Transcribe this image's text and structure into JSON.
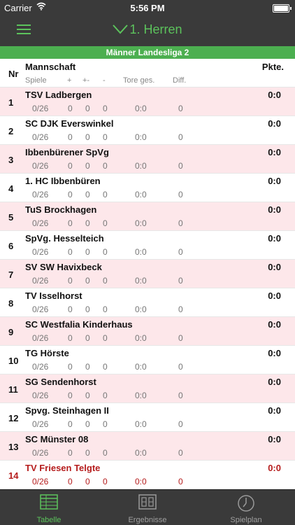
{
  "status_bar": {
    "carrier": "Carrier",
    "time": "5:56 PM"
  },
  "nav": {
    "title": "1. Herren"
  },
  "league": {
    "name": "Männer Landesliga 2"
  },
  "columns": {
    "nr": "Nr",
    "team": "Mannschaft",
    "points": "Pkte.",
    "games": "Spiele",
    "plus": "+",
    "plusminus": "+-",
    "minus": "-",
    "goals": "Tore ges.",
    "diff": "Diff."
  },
  "rows": [
    {
      "nr": "1",
      "team": "TSV Ladbergen",
      "points": "0:0",
      "games": "0/26",
      "plus": "0",
      "plusminus": "0",
      "minus": "0",
      "goals": "0:0",
      "diff": "0"
    },
    {
      "nr": "2",
      "team": "SC DJK Everswinkel",
      "points": "0:0",
      "games": "0/26",
      "plus": "0",
      "plusminus": "0",
      "minus": "0",
      "goals": "0:0",
      "diff": "0"
    },
    {
      "nr": "3",
      "team": "Ibbenbürener SpVg",
      "points": "0:0",
      "games": "0/26",
      "plus": "0",
      "plusminus": "0",
      "minus": "0",
      "goals": "0:0",
      "diff": "0"
    },
    {
      "nr": "4",
      "team": "1. HC Ibbenbüren",
      "points": "0:0",
      "games": "0/26",
      "plus": "0",
      "plusminus": "0",
      "minus": "0",
      "goals": "0:0",
      "diff": "0"
    },
    {
      "nr": "5",
      "team": "TuS Brockhagen",
      "points": "0:0",
      "games": "0/26",
      "plus": "0",
      "plusminus": "0",
      "minus": "0",
      "goals": "0:0",
      "diff": "0"
    },
    {
      "nr": "6",
      "team": "SpVg. Hesselteich",
      "points": "0:0",
      "games": "0/26",
      "plus": "0",
      "plusminus": "0",
      "minus": "0",
      "goals": "0:0",
      "diff": "0"
    },
    {
      "nr": "7",
      "team": "SV SW Havixbeck",
      "points": "0:0",
      "games": "0/26",
      "plus": "0",
      "plusminus": "0",
      "minus": "0",
      "goals": "0:0",
      "diff": "0"
    },
    {
      "nr": "8",
      "team": "TV Isselhorst",
      "points": "0:0",
      "games": "0/26",
      "plus": "0",
      "plusminus": "0",
      "minus": "0",
      "goals": "0:0",
      "diff": "0"
    },
    {
      "nr": "9",
      "team": "SC Westfalia Kinderhaus",
      "points": "0:0",
      "games": "0/26",
      "plus": "0",
      "plusminus": "0",
      "minus": "0",
      "goals": "0:0",
      "diff": "0"
    },
    {
      "nr": "10",
      "team": "TG Hörste",
      "points": "0:0",
      "games": "0/26",
      "plus": "0",
      "plusminus": "0",
      "minus": "0",
      "goals": "0:0",
      "diff": "0"
    },
    {
      "nr": "11",
      "team": "SG Sendenhorst",
      "points": "0:0",
      "games": "0/26",
      "plus": "0",
      "plusminus": "0",
      "minus": "0",
      "goals": "0:0",
      "diff": "0"
    },
    {
      "nr": "12",
      "team": "Spvg. Steinhagen II",
      "points": "0:0",
      "games": "0/26",
      "plus": "0",
      "plusminus": "0",
      "minus": "0",
      "goals": "0:0",
      "diff": "0"
    },
    {
      "nr": "13",
      "team": "SC Münster 08",
      "points": "0:0",
      "games": "0/26",
      "plus": "0",
      "plusminus": "0",
      "minus": "0",
      "goals": "0:0",
      "diff": "0"
    },
    {
      "nr": "14",
      "team": "TV Friesen Telgte",
      "points": "0:0",
      "games": "0/26",
      "plus": "0",
      "plusminus": "0",
      "minus": "0",
      "goals": "0:0",
      "diff": "0",
      "highlight": true
    }
  ],
  "tabs": [
    {
      "label": "Tabelle",
      "icon": "table-icon",
      "active": true
    },
    {
      "label": "Ergebnisse",
      "icon": "scoreboard-icon"
    },
    {
      "label": "Spielplan",
      "icon": "clock-icon"
    }
  ],
  "colors": {
    "accent": "#5cc35c",
    "banner": "#4caf50",
    "bar": "#3a3a3a",
    "alt_row": "#fde7ea",
    "highlight_text": "#b51c1c"
  }
}
